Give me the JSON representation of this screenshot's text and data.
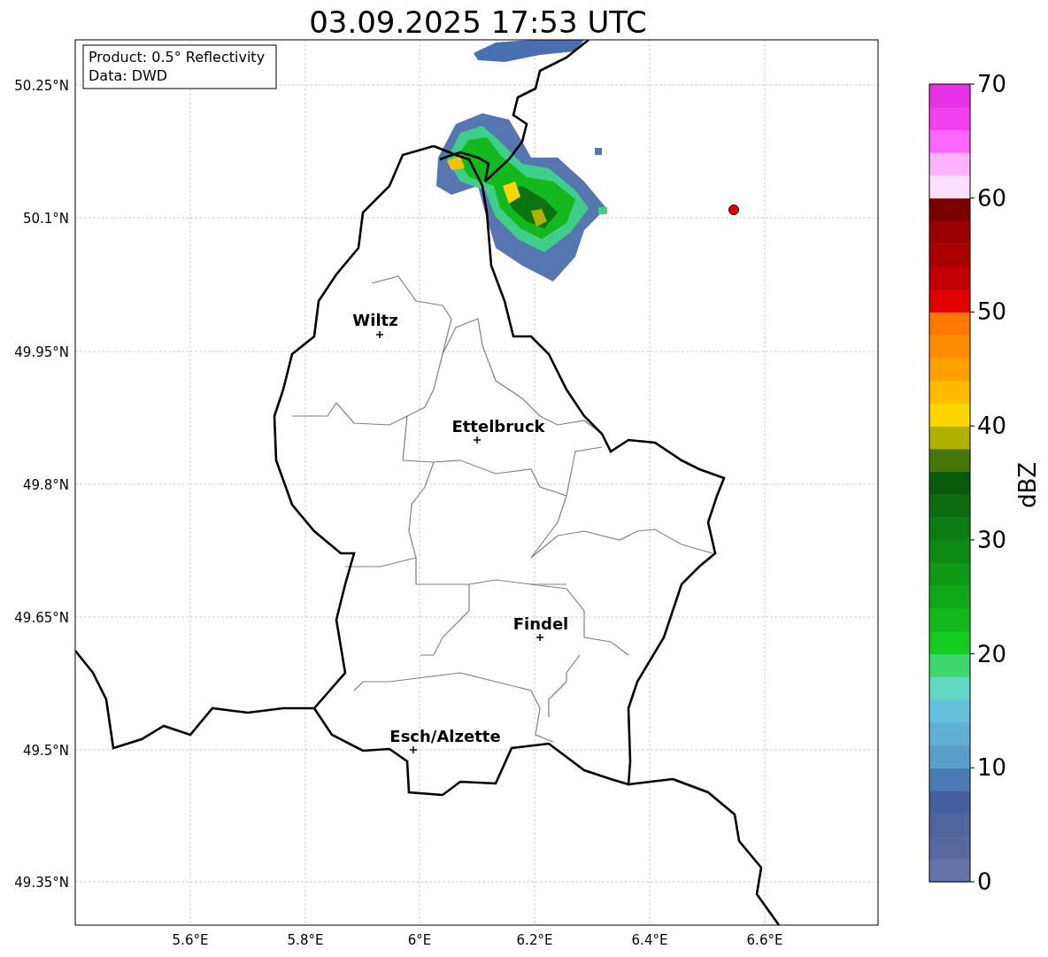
{
  "title": "03.09.2025 17:53 UTC",
  "info_box": [
    "Product: 0.5° Reflectivity",
    "Data: DWD"
  ],
  "map": {
    "lat_ticks": [
      "50.25°N",
      "50.1°N",
      "49.95°N",
      "49.8°N",
      "49.65°N",
      "49.5°N",
      "49.35°N"
    ],
    "lon_ticks": [
      "5.6°E",
      "5.8°E",
      "6°E",
      "6.2°E",
      "6.4°E",
      "6.6°E"
    ],
    "cities": [
      {
        "name": "Wiltz"
      },
      {
        "name": "Ettelbruck"
      },
      {
        "name": "Findel"
      },
      {
        "name": "Esch/Alzette"
      }
    ]
  },
  "colorbar": {
    "label": "dBZ",
    "ticks": [
      "70",
      "60",
      "50",
      "40",
      "30",
      "20",
      "10",
      "0"
    ]
  }
}
